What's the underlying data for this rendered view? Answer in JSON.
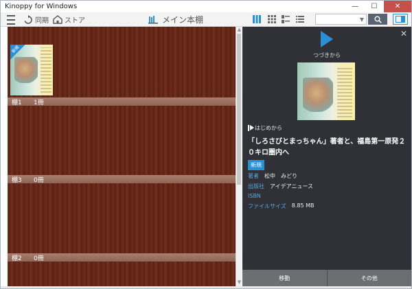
{
  "window": {
    "title": "Kinoppy for Windows",
    "controls": [
      "—",
      "☐",
      "✕"
    ]
  },
  "toolbar": {
    "sync_label": "同期",
    "store_label": "ストア",
    "shelf_title": "メイン本棚",
    "search_placeholder": ""
  },
  "shelves": [
    {
      "name": "棚1",
      "count": "1冊",
      "has_book": true,
      "badge": "新規"
    },
    {
      "name": "棚3",
      "count": "0冊",
      "has_book": false
    },
    {
      "name": "棚2",
      "count": "0冊",
      "has_book": false
    }
  ],
  "panel": {
    "continue_label": "つづきから",
    "from_start_label": "はじめから",
    "book_title": "「しろさびとまっちゃん」著者と、福島第一原発２０キロ圏内へ",
    "tag": "新規",
    "meta": {
      "author_key": "著者",
      "author_val": "松中　みどり",
      "publisher_key": "出版社",
      "publisher_val": "アイデアニュース",
      "isbn_key": "ISBN",
      "isbn_val": "",
      "size_key": "ファイルサイズ",
      "size_val": "8.85 MB"
    },
    "footer_move": "移動",
    "footer_other": "その他"
  },
  "colors": {
    "accent": "#2a8fd4",
    "panel_bg": "#2f3136",
    "shelf_wood": "#6b2a1a"
  }
}
